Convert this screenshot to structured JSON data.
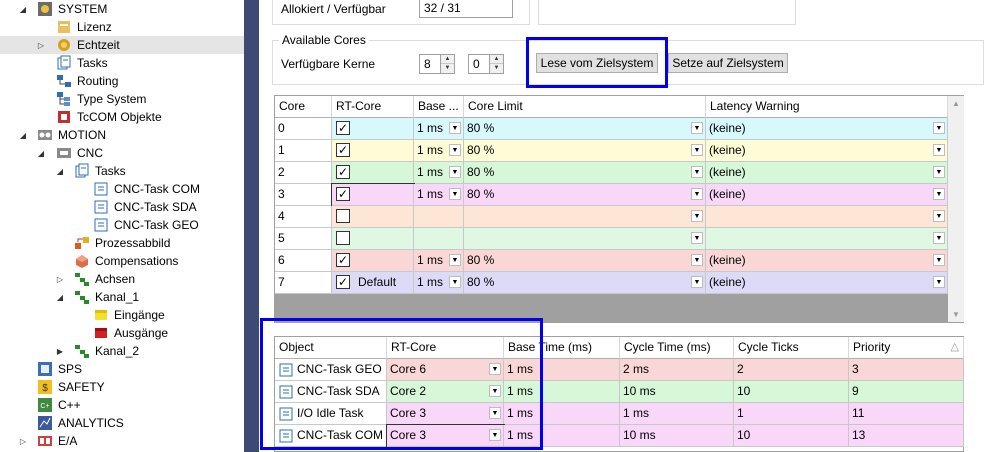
{
  "tree": {
    "items": [
      {
        "label": "SYSTEM",
        "icon": "system-icon"
      },
      {
        "label": "Lizenz",
        "icon": "license-icon"
      },
      {
        "label": "Echtzeit",
        "icon": "realtime-icon"
      },
      {
        "label": "Tasks",
        "icon": "tasks-icon"
      },
      {
        "label": "Routing",
        "icon": "routing-icon"
      },
      {
        "label": "Type System",
        "icon": "type-system-icon"
      },
      {
        "label": "TcCOM Objekte",
        "icon": "tccom-icon"
      },
      {
        "label": "MOTION",
        "icon": "motion-icon"
      },
      {
        "label": "CNC",
        "icon": "cnc-icon"
      },
      {
        "label": "Tasks",
        "icon": "tasks-icon"
      },
      {
        "label": "CNC-Task COM",
        "icon": "task-icon"
      },
      {
        "label": "CNC-Task SDA",
        "icon": "task-icon"
      },
      {
        "label": "CNC-Task GEO",
        "icon": "task-icon"
      },
      {
        "label": "Prozessabbild",
        "icon": "process-image-icon"
      },
      {
        "label": "Compensations",
        "icon": "compensations-icon"
      },
      {
        "label": "Achsen",
        "icon": "axes-icon"
      },
      {
        "label": "Kanal_1",
        "icon": "channel-icon"
      },
      {
        "label": "Eingänge",
        "icon": "inputs-icon"
      },
      {
        "label": "Ausgänge",
        "icon": "outputs-icon"
      },
      {
        "label": "Kanal_2",
        "icon": "channel-icon"
      },
      {
        "label": "SPS",
        "icon": "plc-icon"
      },
      {
        "label": "SAFETY",
        "icon": "safety-icon"
      },
      {
        "label": "C++",
        "icon": "cpp-icon"
      },
      {
        "label": "ANALYTICS",
        "icon": "analytics-icon"
      },
      {
        "label": "E/A",
        "icon": "io-icon"
      }
    ]
  },
  "settings": {
    "allocated_label": "Allokiert / Verfügbar",
    "allocated_value": "32 / 31",
    "available_cores_title": "Available Cores",
    "available_label": "Verfügbare Kerne",
    "available_value_1": "8",
    "available_value_2": "0",
    "read_button": "Lese vom Zielsystem",
    "write_button": "Setze auf Zielsystem"
  },
  "core_grid": {
    "headers": [
      "Core",
      "RT-Core",
      "Base ...",
      "Core Limit",
      "Latency Warning"
    ],
    "rows": [
      {
        "core": "0",
        "rt": true,
        "default": "",
        "base": "1 ms",
        "limit": "80 %",
        "latency": "(keine)",
        "color": "#d7f8fc"
      },
      {
        "core": "1",
        "rt": true,
        "default": "",
        "base": "1 ms",
        "limit": "80 %",
        "latency": "(keine)",
        "color": "#fdfcd6"
      },
      {
        "core": "2",
        "rt": true,
        "default": "",
        "base": "1 ms",
        "limit": "80 %",
        "latency": "(keine)",
        "color": "#d7f8d8"
      },
      {
        "core": "3",
        "rt": true,
        "default": "",
        "base": "1 ms",
        "limit": "80 %",
        "latency": "(keine)",
        "color": "#f9d7f9"
      },
      {
        "core": "4",
        "rt": false,
        "default": "",
        "base": "",
        "limit": "",
        "latency": "",
        "color": "#fde6d6"
      },
      {
        "core": "5",
        "rt": false,
        "default": "",
        "base": "",
        "limit": "",
        "latency": "",
        "color": "#e0f7e3"
      },
      {
        "core": "6",
        "rt": true,
        "default": "",
        "base": "1 ms",
        "limit": "80 %",
        "latency": "(keine)",
        "color": "#fad7d7"
      },
      {
        "core": "7",
        "rt": true,
        "default": "Default",
        "base": "1 ms",
        "limit": "80 %",
        "latency": "(keine)",
        "color": "#dddaf8"
      }
    ]
  },
  "object_grid": {
    "headers": [
      "Object",
      "RT-Core",
      "Base Time (ms)",
      "Cycle Time (ms)",
      "Cycle Ticks",
      "Priority"
    ],
    "rows": [
      {
        "object": "CNC-Task GEO",
        "rt": "Core 6",
        "base": "1 ms",
        "cycle": "2 ms",
        "ticks": "2",
        "priority": "3",
        "color": "#fad7d7"
      },
      {
        "object": "CNC-Task SDA",
        "rt": "Core 2",
        "base": "1 ms",
        "cycle": "10 ms",
        "ticks": "10",
        "priority": "9",
        "color": "#d7f8d8"
      },
      {
        "object": "I/O Idle Task",
        "rt": "Core 3",
        "base": "1 ms",
        "cycle": "1 ms",
        "ticks": "1",
        "priority": "11",
        "color": "#f9d7f9"
      },
      {
        "object": "CNC-Task COM",
        "rt": "Core 3",
        "base": "1 ms",
        "cycle": "10 ms",
        "ticks": "10",
        "priority": "13",
        "color": "#f9d7f9"
      }
    ]
  },
  "colors": {
    "splitter": "#3c4a74",
    "highlight": "#0000ee"
  }
}
